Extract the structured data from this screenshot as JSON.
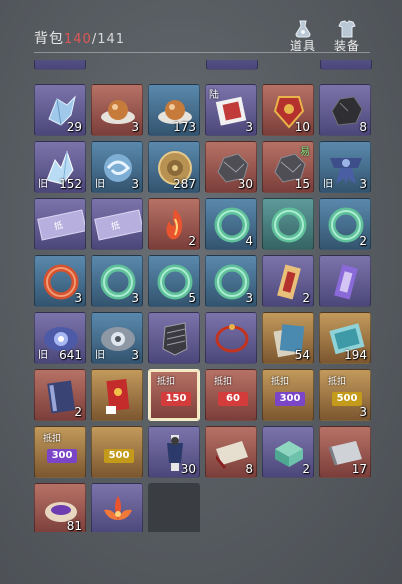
{
  "header": {
    "title": "背包",
    "count": "140",
    "capacity": "/141",
    "tabs": [
      {
        "label": "道具",
        "icon": "flask-icon"
      },
      {
        "label": "装备",
        "icon": "armor-icon"
      }
    ]
  },
  "colors": {
    "count_red": "#e05757"
  },
  "slots": [
    {
      "qty": "29",
      "icon": "crystal-icon",
      "rarity": "purple"
    },
    {
      "qty": "3",
      "icon": "golden-orb-icon",
      "rarity": "red"
    },
    {
      "qty": "173",
      "icon": "golden-orb-icon",
      "rarity": "blue"
    },
    {
      "qty": "3",
      "icon": "red-talisman-icon",
      "rarity": "purple",
      "top_left": "陆"
    },
    {
      "qty": "10",
      "icon": "red-medal-icon",
      "rarity": "red"
    },
    {
      "qty": "8",
      "icon": "black-ore-icon",
      "rarity": "purple"
    },
    {
      "qty": "152",
      "icon": "ice-crystal-icon",
      "rarity": "purple",
      "bound": "旧"
    },
    {
      "qty": "3",
      "icon": "swirl-orb-icon",
      "rarity": "blue",
      "bound": "旧"
    },
    {
      "qty": "287",
      "icon": "bronze-coin-icon",
      "rarity": "blue"
    },
    {
      "qty": "30",
      "icon": "grey-ore-icon",
      "rarity": "red"
    },
    {
      "qty": "15",
      "icon": "grey-ore-icon",
      "rarity": "red",
      "top_right": "易"
    },
    {
      "qty": "3",
      "icon": "ribbon-knot-icon",
      "rarity": "blue",
      "bound": "旧"
    },
    {
      "qty": "",
      "icon": "coupon-card-icon",
      "rarity": "purple",
      "card_text": "抵"
    },
    {
      "qty": "",
      "icon": "coupon-card-icon",
      "rarity": "purple",
      "card_text": "抵"
    },
    {
      "qty": "2",
      "icon": "fire-feather-icon",
      "rarity": "red"
    },
    {
      "qty": "4",
      "icon": "jade-ring-icon",
      "rarity": "blue"
    },
    {
      "qty": "",
      "icon": "jade-ring-icon",
      "rarity": "teal"
    },
    {
      "qty": "2",
      "icon": "jade-ring-icon",
      "rarity": "blue"
    },
    {
      "qty": "3",
      "icon": "red-ring-icon",
      "rarity": "blue"
    },
    {
      "qty": "3",
      "icon": "jade-ring-icon",
      "rarity": "blue"
    },
    {
      "qty": "5",
      "icon": "jade-ring-icon",
      "rarity": "blue"
    },
    {
      "qty": "3",
      "icon": "jade-ring-icon",
      "rarity": "blue"
    },
    {
      "qty": "2",
      "icon": "scroll-tag-icon",
      "rarity": "purple"
    },
    {
      "qty": "",
      "icon": "purple-tag-icon",
      "rarity": "purple"
    },
    {
      "qty": "641",
      "icon": "eye-orb-icon",
      "rarity": "purple",
      "bound": "旧"
    },
    {
      "qty": "3",
      "icon": "grey-eye-orb-icon",
      "rarity": "blue",
      "bound": "旧"
    },
    {
      "qty": "",
      "icon": "armor-piece-icon",
      "rarity": "purple"
    },
    {
      "qty": "",
      "icon": "red-bracelet-icon",
      "rarity": "purple"
    },
    {
      "qty": "54",
      "icon": "blue-book-stack-icon",
      "rarity": "orange"
    },
    {
      "qty": "194",
      "icon": "teal-map-icon",
      "rarity": "orange"
    },
    {
      "qty": "2",
      "icon": "book-icon",
      "rarity": "red"
    },
    {
      "qty": "",
      "icon": "red-envelope-icon",
      "rarity": "orange"
    },
    {
      "qty": "",
      "icon": "coupon-150-icon",
      "rarity": "red",
      "coupon_title": "抵扣",
      "coupon_value": "150",
      "coupon_color": "#d43b3b",
      "selected": true
    },
    {
      "qty": "",
      "icon": "coupon-60-icon",
      "rarity": "red",
      "coupon_title": "抵扣",
      "coupon_value": "60",
      "coupon_color": "#d43b3b"
    },
    {
      "qty": "",
      "icon": "coupon-300-icon",
      "rarity": "orange",
      "coupon_title": "抵扣",
      "coupon_value": "300",
      "coupon_color": "#7b45c8"
    },
    {
      "qty": "3",
      "icon": "coupon-500-icon",
      "rarity": "orange",
      "coupon_title": "抵扣",
      "coupon_value": "500",
      "coupon_color": "#c49a1a"
    },
    {
      "qty": "",
      "icon": "coupon-300-icon",
      "rarity": "orange",
      "coupon_title": "抵扣",
      "coupon_value": "300",
      "coupon_color": "#7b45c8"
    },
    {
      "qty": "",
      "icon": "coupon-500-icon",
      "rarity": "orange",
      "coupon_title": "",
      "coupon_value": "500",
      "coupon_color": "#c49a1a"
    },
    {
      "qty": "30",
      "icon": "puppet-icon",
      "rarity": "purple"
    },
    {
      "qty": "8",
      "icon": "folded-paper-icon",
      "rarity": "red"
    },
    {
      "qty": "2",
      "icon": "jade-box-icon",
      "rarity": "purple"
    },
    {
      "qty": "17",
      "icon": "silver-fan-icon",
      "rarity": "red"
    },
    {
      "qty": "81",
      "icon": "bowl-icon",
      "rarity": "red"
    },
    {
      "qty": "",
      "icon": "lotus-icon",
      "rarity": "purple"
    },
    {
      "qty": "",
      "icon": "empty-slot",
      "rarity": "empty"
    }
  ]
}
